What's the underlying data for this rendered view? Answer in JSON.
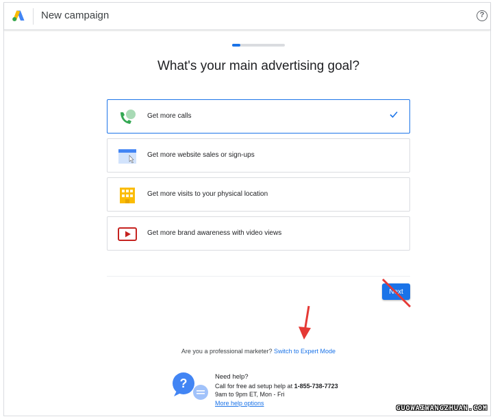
{
  "header": {
    "title": "New campaign",
    "help_symbol": "?"
  },
  "progress": {
    "value": 0.15
  },
  "heading": "What's your main advertising goal?",
  "goals": [
    {
      "label": "Get more calls",
      "icon": "phone-icon",
      "selected": true
    },
    {
      "label": "Get more website sales or sign-ups",
      "icon": "website-icon",
      "selected": false
    },
    {
      "label": "Get more visits to your physical location",
      "icon": "building-icon",
      "selected": false
    },
    {
      "label": "Get more brand awareness with video views",
      "icon": "video-play-icon",
      "selected": false
    }
  ],
  "next_button": "Next",
  "expert": {
    "prompt": "Are you a professional marketer?",
    "link": "Switch to Expert Mode"
  },
  "help": {
    "title": "Need help?",
    "line1_prefix": "Call for free ad setup help at",
    "phone": "1-855-738-7723",
    "hours": "9am to 9pm ET, Mon - Fri",
    "link": "More help options"
  },
  "watermark": "GUOWAIWANGZHUAN.COM",
  "colors": {
    "accent": "#1a73e8",
    "annotation": "#e53935",
    "border": "#dadce0"
  }
}
